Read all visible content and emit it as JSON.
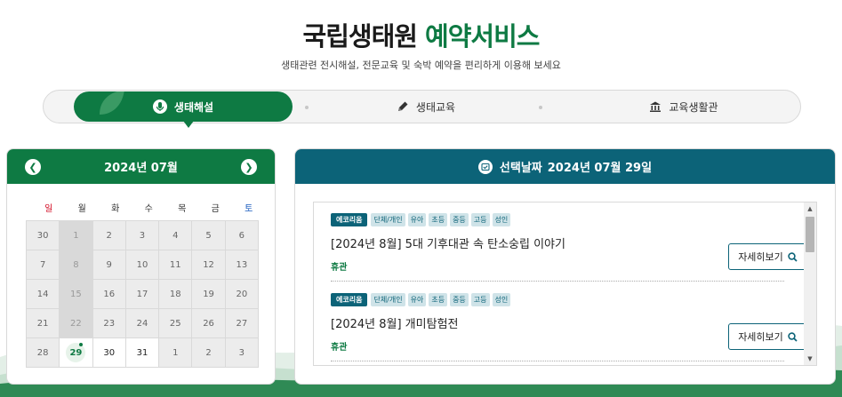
{
  "header": {
    "title_part1": "국립생태원",
    "title_part2": "예약서비스",
    "subtitle": "생태관련 전시해설, 전문교육 및 숙박 예약을 편리하게 이용해 보세요"
  },
  "tabs": [
    {
      "label": "생태해설",
      "icon": "microphone-icon",
      "active": true
    },
    {
      "label": "생태교육",
      "icon": "pencil-icon",
      "active": false
    },
    {
      "label": "교육생활관",
      "icon": "building-icon",
      "active": false
    }
  ],
  "calendar": {
    "month_label": "2024년 07월",
    "prev_icon": "chevron-left-icon",
    "next_icon": "chevron-right-icon",
    "weekdays": [
      "일",
      "월",
      "화",
      "수",
      "목",
      "금",
      "토"
    ],
    "days": [
      "30",
      "1",
      "2",
      "3",
      "4",
      "5",
      "6",
      "7",
      "8",
      "9",
      "10",
      "11",
      "12",
      "13",
      "14",
      "15",
      "16",
      "17",
      "18",
      "19",
      "20",
      "21",
      "22",
      "23",
      "24",
      "25",
      "26",
      "27",
      "28",
      "29",
      "30",
      "31",
      "1",
      "2",
      "3"
    ],
    "selected_day": "29"
  },
  "program": {
    "header_label": "선택날짜",
    "header_date": "2024년 07월 29일",
    "header_icon": "calendar-check-icon",
    "items": [
      {
        "badge": "에코리움",
        "tags": [
          "단체/개인",
          "유아",
          "초등",
          "중등",
          "고등",
          "성인"
        ],
        "title": "[2024년 8월] 5대 기후대관 속 탄소숭립 이야기",
        "status": "휴관",
        "button_label": "자세히보기"
      },
      {
        "badge": "에코리움",
        "tags": [
          "단체/개인",
          "유아",
          "초등",
          "중등",
          "고등",
          "성인"
        ],
        "title": "[2024년 8월] 개미탐험전",
        "status": "휴관",
        "button_label": "자세히보기"
      }
    ]
  },
  "colors": {
    "green": "#0e7a43",
    "teal": "#0c6378"
  }
}
